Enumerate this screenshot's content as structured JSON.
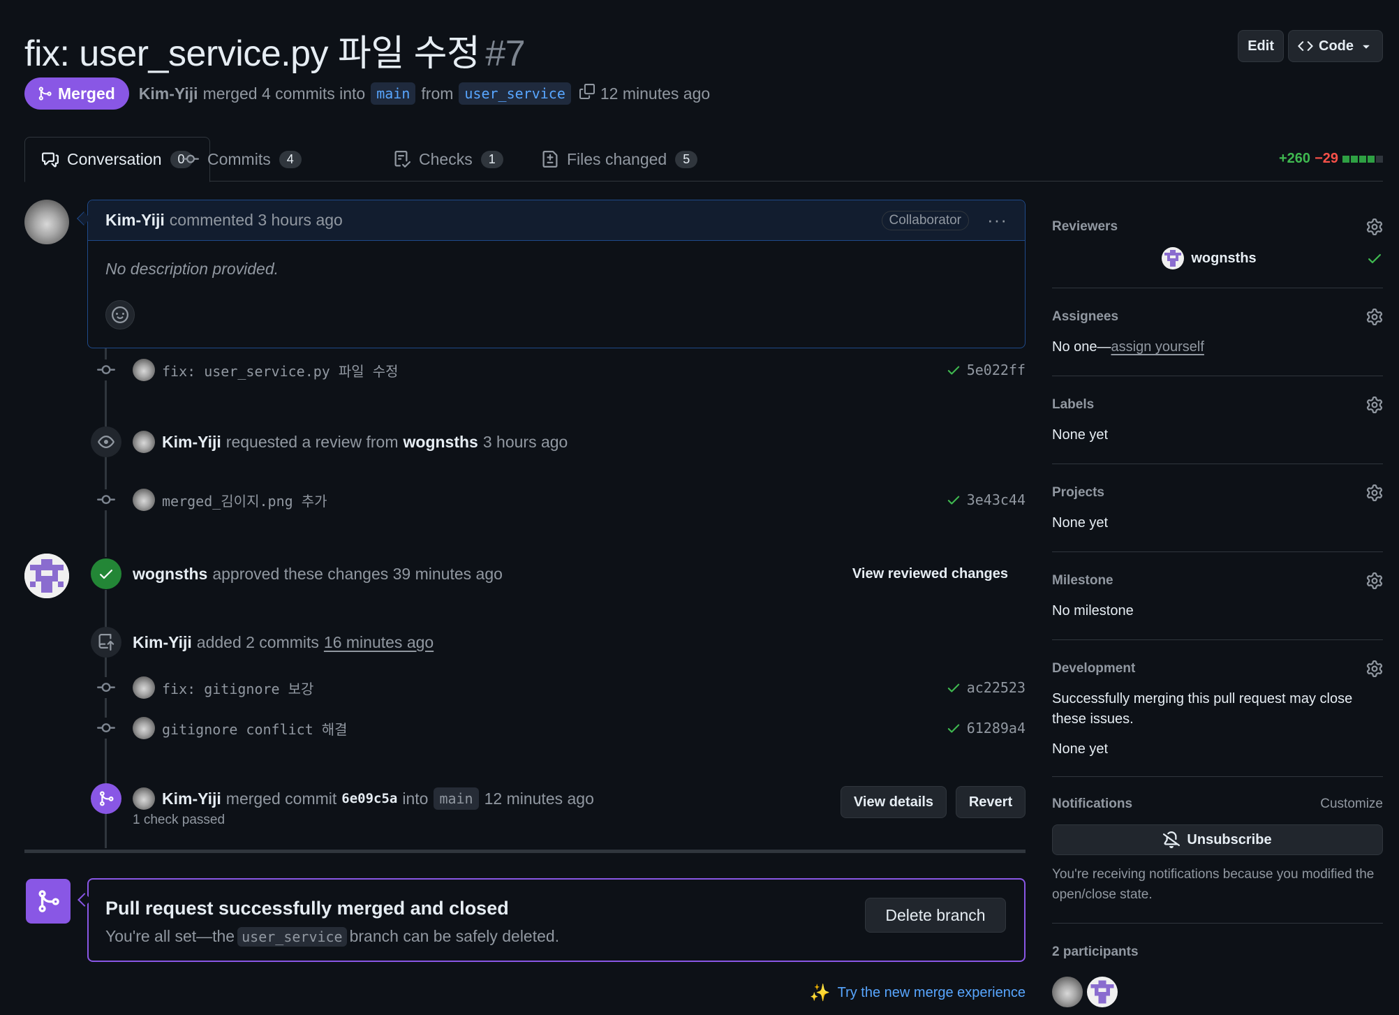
{
  "header": {
    "title": "fix: user_service.py 파일 수정",
    "number": "#7",
    "edit_label": "Edit",
    "code_label": "Code"
  },
  "meta": {
    "state": "Merged",
    "author": "Kim-Yiji",
    "action": "merged 4 commits into",
    "base_branch": "main",
    "from_word": "from",
    "head_branch": "user_service",
    "time": "12 minutes ago"
  },
  "tabs": [
    {
      "label": "Conversation",
      "count": "0"
    },
    {
      "label": "Commits",
      "count": "4"
    },
    {
      "label": "Checks",
      "count": "1"
    },
    {
      "label": "Files changed",
      "count": "5"
    }
  ],
  "diffstat": {
    "additions": "+260",
    "deletions": "−29"
  },
  "comment": {
    "author": "Kim-Yiji",
    "action": "commented 3 hours ago",
    "role": "Collaborator",
    "body": "No description provided."
  },
  "timeline": {
    "commit1": {
      "message": "fix: user_service.py 파일 수정",
      "sha": "5e022ff"
    },
    "review_request": {
      "author": "Kim-Yiji",
      "text": "requested a review from",
      "reviewer": "wognsths",
      "time": "3 hours ago"
    },
    "commit2": {
      "message": "merged_김이지.png 추가",
      "sha": "3e43c44"
    },
    "approval": {
      "reviewer": "wognsths",
      "text": "approved these changes 39 minutes ago",
      "link": "View reviewed changes"
    },
    "added_commits": {
      "author": "Kim-Yiji",
      "text": "added 2 commits",
      "time": "16 minutes ago"
    },
    "commit3": {
      "message": "fix: gitignore 보강",
      "sha": "ac22523"
    },
    "commit4": {
      "message": "gitignore conflict 해결",
      "sha": "61289a4"
    },
    "merge_event": {
      "author": "Kim-Yiji",
      "text": "merged commit",
      "sha": "6e09c5a",
      "into": "into",
      "branch": "main",
      "time": "12 minutes ago",
      "checks": "1 check passed",
      "view_details": "View details",
      "revert": "Revert"
    }
  },
  "merge_box": {
    "title": "Pull request successfully merged and closed",
    "sub_before": "You're all set—the",
    "branch": "user_service",
    "sub_after": "branch can be safely deleted.",
    "delete_label": "Delete branch",
    "try_new": "Try the new merge experience"
  },
  "sidebar": {
    "reviewers": {
      "heading": "Reviewers",
      "name": "wognsths"
    },
    "assignees": {
      "heading": "Assignees",
      "prefix": "No one—",
      "link": "assign yourself"
    },
    "labels": {
      "heading": "Labels",
      "value": "None yet"
    },
    "projects": {
      "heading": "Projects",
      "value": "None yet"
    },
    "milestone": {
      "heading": "Milestone",
      "value": "No milestone"
    },
    "development": {
      "heading": "Development",
      "note": "Successfully merging this pull request may close these issues.",
      "value": "None yet"
    },
    "notifications": {
      "heading": "Notifications",
      "customize": "Customize",
      "button": "Unsubscribe",
      "note": "You're receiving notifications because you modified the open/close state."
    },
    "participants": {
      "heading": "2 participants"
    }
  },
  "colors": {
    "accent_merged": "#8957e5",
    "success": "#3fb950",
    "link": "#58a6ff",
    "background": "#0d1117"
  }
}
